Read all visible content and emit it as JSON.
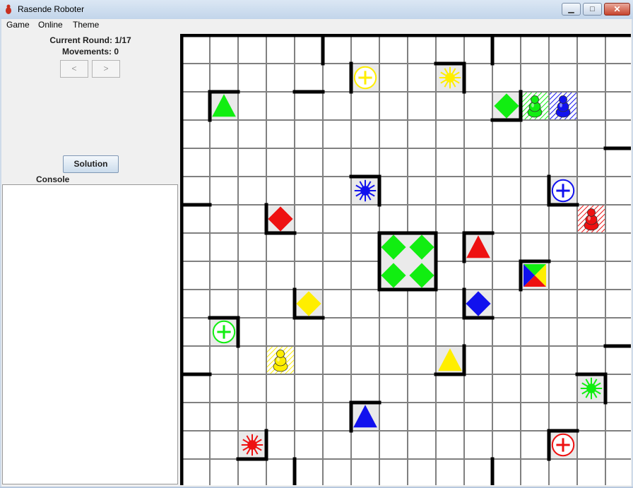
{
  "window": {
    "title": "Rasende Roboter",
    "minimize_glyph": "▁",
    "maximize_glyph": "□",
    "close_glyph": "✕"
  },
  "menu": [
    "Game",
    "Online",
    "Theme"
  ],
  "panel": {
    "round_text": "Current Round: 1/17",
    "movements_text": "Movements: 0",
    "prev_label": "<",
    "next_label": ">",
    "solution_label": "Solution",
    "console_label": "Console",
    "console_text": ""
  },
  "board": {
    "size": 16,
    "colors": {
      "red": "#ee1111",
      "green": "#11ee11",
      "blue": "#1111ee",
      "yellow": "#ffee00",
      "grid": "#808080",
      "wall": "#000000",
      "target_bg": "#eaeaea"
    },
    "walls": [
      {
        "r": 0,
        "c": 5,
        "side": "left"
      },
      {
        "r": 0,
        "c": 11,
        "side": "left"
      },
      {
        "r": 1,
        "c": 4,
        "side": "bottom"
      },
      {
        "r": 1,
        "c": 6,
        "side": "left"
      },
      {
        "r": 1,
        "c": 9,
        "side": "top"
      },
      {
        "r": 1,
        "c": 9,
        "side": "right"
      },
      {
        "r": 2,
        "c": 1,
        "side": "top"
      },
      {
        "r": 2,
        "c": 1,
        "side": "left"
      },
      {
        "r": 2,
        "c": 11,
        "side": "bottom"
      },
      {
        "r": 2,
        "c": 11,
        "side": "right"
      },
      {
        "r": 4,
        "c": 15,
        "side": "top"
      },
      {
        "r": 5,
        "c": 6,
        "side": "top"
      },
      {
        "r": 5,
        "c": 6,
        "side": "right"
      },
      {
        "r": 5,
        "c": 13,
        "side": "left"
      },
      {
        "r": 5,
        "c": 13,
        "side": "bottom"
      },
      {
        "r": 6,
        "c": 0,
        "side": "top"
      },
      {
        "r": 6,
        "c": 3,
        "side": "left"
      },
      {
        "r": 6,
        "c": 3,
        "side": "bottom"
      },
      {
        "r": 7,
        "c": 7,
        "side": "top"
      },
      {
        "r": 7,
        "c": 8,
        "side": "top"
      },
      {
        "r": 7,
        "c": 7,
        "side": "left"
      },
      {
        "r": 8,
        "c": 7,
        "side": "left"
      },
      {
        "r": 7,
        "c": 8,
        "side": "right"
      },
      {
        "r": 8,
        "c": 8,
        "side": "right"
      },
      {
        "r": 8,
        "c": 7,
        "side": "bottom"
      },
      {
        "r": 8,
        "c": 8,
        "side": "bottom"
      },
      {
        "r": 7,
        "c": 10,
        "side": "top"
      },
      {
        "r": 7,
        "c": 10,
        "side": "left"
      },
      {
        "r": 8,
        "c": 12,
        "side": "top"
      },
      {
        "r": 8,
        "c": 12,
        "side": "left"
      },
      {
        "r": 9,
        "c": 4,
        "side": "left"
      },
      {
        "r": 9,
        "c": 4,
        "side": "bottom"
      },
      {
        "r": 9,
        "c": 10,
        "side": "left"
      },
      {
        "r": 9,
        "c": 10,
        "side": "bottom"
      },
      {
        "r": 10,
        "c": 1,
        "side": "top"
      },
      {
        "r": 10,
        "c": 1,
        "side": "right"
      },
      {
        "r": 11,
        "c": 15,
        "side": "top"
      },
      {
        "r": 11,
        "c": 9,
        "side": "right"
      },
      {
        "r": 11,
        "c": 9,
        "side": "bottom"
      },
      {
        "r": 12,
        "c": 0,
        "side": "top"
      },
      {
        "r": 12,
        "c": 14,
        "side": "top"
      },
      {
        "r": 12,
        "c": 14,
        "side": "right"
      },
      {
        "r": 13,
        "c": 6,
        "side": "top"
      },
      {
        "r": 13,
        "c": 6,
        "side": "left"
      },
      {
        "r": 14,
        "c": 2,
        "side": "right"
      },
      {
        "r": 14,
        "c": 2,
        "side": "bottom"
      },
      {
        "r": 14,
        "c": 13,
        "side": "top"
      },
      {
        "r": 14,
        "c": 13,
        "side": "left"
      },
      {
        "r": 15,
        "c": 4,
        "side": "left"
      },
      {
        "r": 15,
        "c": 11,
        "side": "left"
      }
    ],
    "targets": [
      {
        "r": 1,
        "c": 6,
        "color": "yellow",
        "shape": "cross",
        "icon": "yellow-cross-target-icon"
      },
      {
        "r": 1,
        "c": 9,
        "color": "yellow",
        "shape": "sun",
        "icon": "yellow-sun-target-icon"
      },
      {
        "r": 2,
        "c": 1,
        "color": "green",
        "shape": "triangle",
        "icon": "green-triangle-target-icon"
      },
      {
        "r": 2,
        "c": 11,
        "color": "green",
        "shape": "diamond",
        "icon": "green-diamond-target-icon"
      },
      {
        "r": 5,
        "c": 6,
        "color": "blue",
        "shape": "sun",
        "icon": "blue-sun-target-icon"
      },
      {
        "r": 5,
        "c": 13,
        "color": "blue",
        "shape": "cross",
        "icon": "blue-cross-target-icon"
      },
      {
        "r": 6,
        "c": 3,
        "color": "red",
        "shape": "diamond",
        "icon": "red-diamond-target-icon"
      },
      {
        "r": 7,
        "c": 10,
        "color": "red",
        "shape": "triangle",
        "icon": "red-triangle-target-icon"
      },
      {
        "r": 8,
        "c": 12,
        "color": "multi",
        "shape": "vortex",
        "icon": "vortex-target-icon"
      },
      {
        "r": 9,
        "c": 4,
        "color": "yellow",
        "shape": "diamond",
        "icon": "yellow-diamond-target-icon"
      },
      {
        "r": 9,
        "c": 10,
        "color": "blue",
        "shape": "diamond",
        "icon": "blue-diamond-target-icon"
      },
      {
        "r": 10,
        "c": 1,
        "color": "green",
        "shape": "cross",
        "icon": "green-cross-target-icon"
      },
      {
        "r": 11,
        "c": 9,
        "color": "yellow",
        "shape": "triangle",
        "icon": "yellow-triangle-target-icon"
      },
      {
        "r": 12,
        "c": 14,
        "color": "green",
        "shape": "sun",
        "icon": "green-sun-target-icon"
      },
      {
        "r": 13,
        "c": 6,
        "color": "blue",
        "shape": "triangle",
        "icon": "blue-triangle-target-icon"
      },
      {
        "r": 14,
        "c": 2,
        "color": "red",
        "shape": "sun",
        "icon": "red-sun-target-icon"
      },
      {
        "r": 14,
        "c": 13,
        "color": "red",
        "shape": "cross",
        "icon": "red-cross-target-icon"
      }
    ],
    "current_target": {
      "color": "green",
      "shape": "diamond",
      "icon": "green-diamond-current-target-icon"
    },
    "robots": [
      {
        "r": 2,
        "c": 12,
        "color": "green",
        "icon": "green-robot-icon"
      },
      {
        "r": 2,
        "c": 13,
        "color": "blue",
        "icon": "blue-robot-icon"
      },
      {
        "r": 6,
        "c": 14,
        "color": "red",
        "icon": "red-robot-icon"
      },
      {
        "r": 11,
        "c": 3,
        "color": "yellow",
        "icon": "yellow-robot-icon"
      }
    ]
  }
}
